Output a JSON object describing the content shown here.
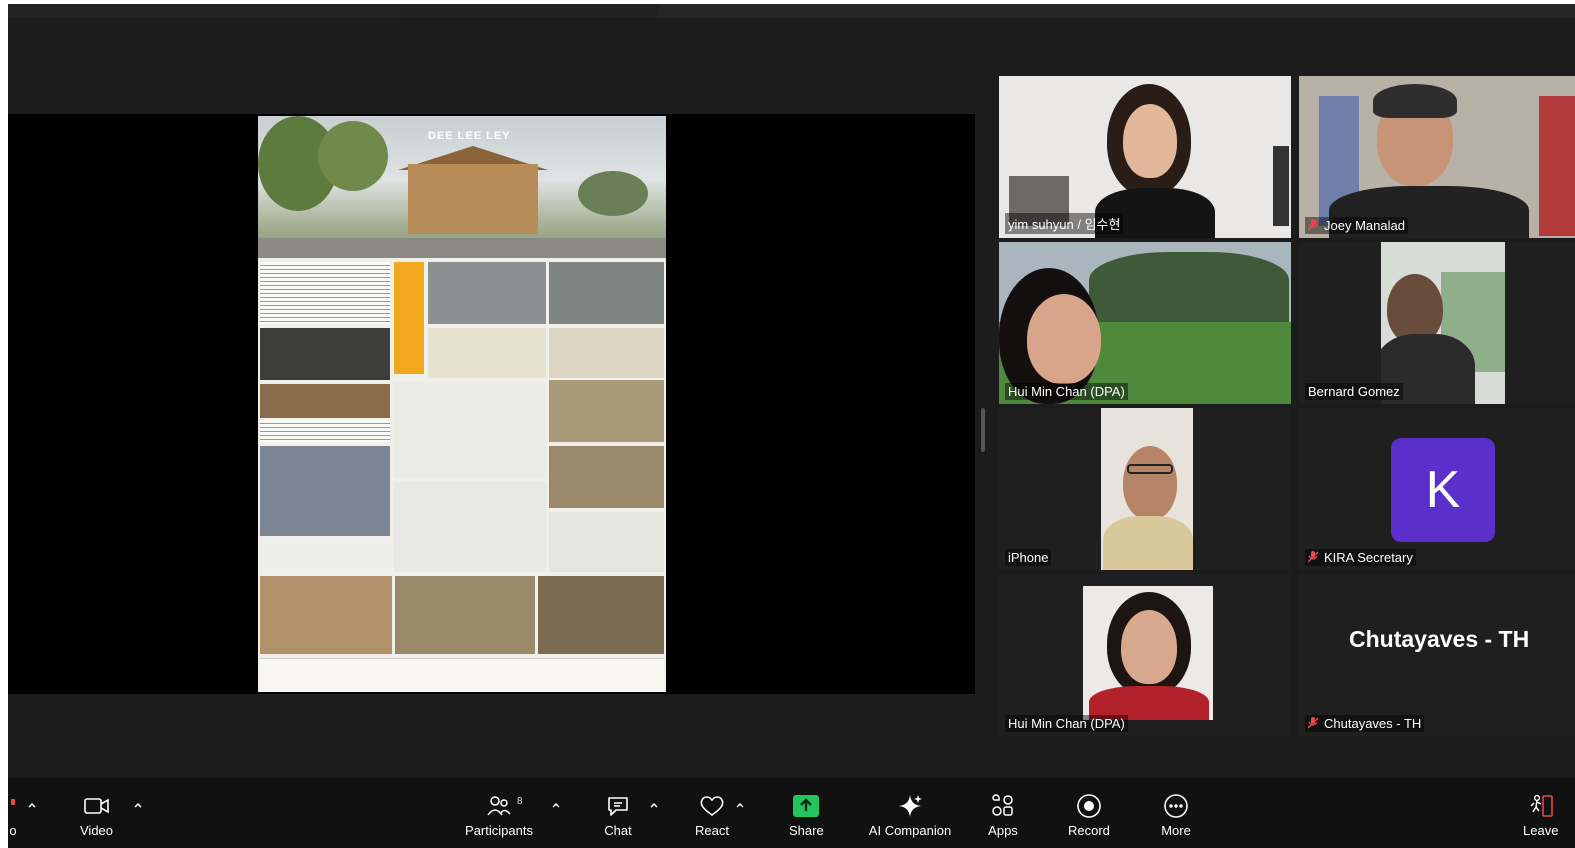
{
  "poster": {
    "title": "DEE LEE LEY"
  },
  "participants": [
    {
      "id": "p1",
      "name": "yim suhyun / 임수현",
      "muted": false,
      "active": true
    },
    {
      "id": "p2",
      "name": "Joey Manalad",
      "muted": true
    },
    {
      "id": "p3",
      "name": "Hui Min Chan (DPA)",
      "muted": false
    },
    {
      "id": "p4",
      "name": "Bernard Gomez",
      "muted": false
    },
    {
      "id": "p5",
      "name": "iPhone",
      "muted": false
    },
    {
      "id": "p6",
      "name": "KIRA Secretary",
      "muted": true,
      "avatar_letter": "K",
      "avatar_color": "#5b2fc9"
    },
    {
      "id": "p7",
      "name": "Hui Min Chan (DPA)",
      "muted": false
    },
    {
      "id": "p8",
      "name": "Chutayaves - TH",
      "muted": true,
      "display_text": "Chutayaves - TH"
    }
  ],
  "toolbar": {
    "audio_partial_label": "o",
    "video_label": "Video",
    "participants_label": "Participants",
    "participants_count": "8",
    "chat_label": "Chat",
    "react_label": "React",
    "share_label": "Share",
    "ai_label": "AI Companion",
    "apps_label": "Apps",
    "record_label": "Record",
    "more_label": "More",
    "leave_label": "Leave"
  },
  "colors": {
    "active_speaker": "#22c55e",
    "share_green": "#22c55e",
    "mute_red": "#e5484d",
    "leave_red": "#e5484d",
    "avatar_purple": "#5b2fc9"
  }
}
